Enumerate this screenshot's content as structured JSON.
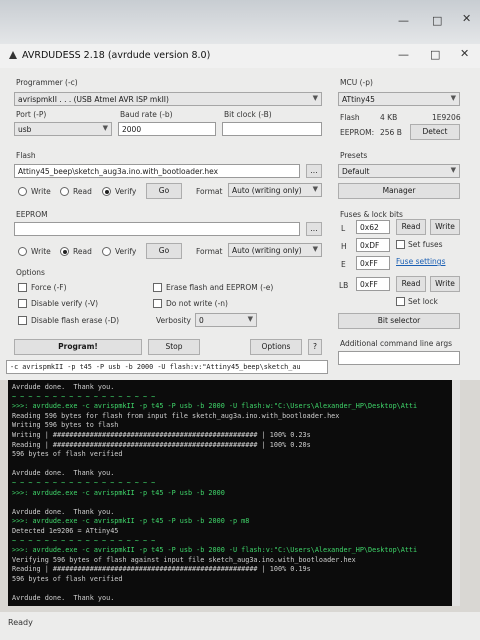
{
  "window": {
    "title": "AVRDUDESS 2.18 (avrdude version 8.0)",
    "status": "Ready"
  },
  "programmer": {
    "label": "Programmer (-c)",
    "value": "avrispmkII . . . (USB Atmel AVR ISP mkII)"
  },
  "port": {
    "label": "Port (-P)",
    "value": "usb"
  },
  "baud": {
    "label": "Baud rate (-b)",
    "value": "2000"
  },
  "bitclock": {
    "label": "Bit clock (-B)",
    "value": ""
  },
  "flash": {
    "label": "Flash",
    "file": "Attiny45_beep\\sketch_aug3a.ino.with_bootloader.hex",
    "browse": "...",
    "write": "Write",
    "read": "Read",
    "verify": "Verify",
    "selected": "verify",
    "go": "Go",
    "format_label": "Format",
    "format": "Auto (writing only)"
  },
  "eeprom": {
    "label": "EEPROM",
    "file": "",
    "browse": "...",
    "write": "Write",
    "read": "Read",
    "verify": "Verify",
    "selected": "read",
    "go": "Go",
    "format_label": "Format",
    "format": "Auto (writing only)"
  },
  "options": {
    "label": "Options",
    "force": "Force (-F)",
    "disable_verify": "Disable verify (-V)",
    "disable_flash_erase": "Disable flash erase (-D)",
    "erase": "Erase flash and EEPROM (-e)",
    "no_write": "Do not write (-n)",
    "verbosity_label": "Verbosity",
    "verbosity": "0"
  },
  "actions": {
    "program": "Program!",
    "stop": "Stop",
    "options": "Options",
    "help": "?"
  },
  "command": "-c avrispmkII -p t45 -P usb -b 2000 -U flash:v:\"Attiny45_beep\\sketch_au",
  "mcu": {
    "label": "MCU (-p)",
    "value": "ATtiny45",
    "flash_label": "Flash",
    "flash_size": "4 KB",
    "signature": "1E9206",
    "eeprom_label": "EEPROM:",
    "eeprom_size": "256 B",
    "detect": "Detect"
  },
  "presets": {
    "label": "Presets",
    "value": "Default",
    "manager": "Manager"
  },
  "fuses": {
    "label": "Fuses & lock bits",
    "l_label": "L",
    "l": "0x62",
    "h_label": "H",
    "h": "0xDF",
    "e_label": "E",
    "e": "0xFF",
    "lb_label": "LB",
    "lb": "0xFF",
    "read": "Read",
    "write": "Write",
    "set_fuses": "Set fuses",
    "fuse_settings": "Fuse settings",
    "set_lock": "Set lock",
    "bit_selector": "Bit selector"
  },
  "additional": {
    "label": "Additional command line args",
    "value": ""
  },
  "terminal": [
    {
      "text": "Avrdude done.  Thank you.",
      "style": "white"
    },
    {
      "text": "~ ~ ~ ~ ~ ~ ~ ~ ~ ~ ~ ~ ~ ~ ~ ~ ~ ~",
      "style": "green"
    },
    {
      "text": ">>>: avrdude.exe -c avrispmkII -p t45 -P usb -b 2000 -U flash:w:\"C:\\Users\\Alexander_HP\\Desktop\\Atti",
      "style": "green"
    },
    {
      "text": "Reading 596 bytes for flash from input file sketch_aug3a.ino.with_bootloader.hex",
      "style": "white"
    },
    {
      "text": "Writing 596 bytes to flash",
      "style": "white"
    },
    {
      "text": "Writing | ################################################## | 100% 0.23s",
      "style": "white"
    },
    {
      "text": "Reading | ################################################## | 100% 0.20s",
      "style": "white"
    },
    {
      "text": "596 bytes of flash verified",
      "style": "white"
    },
    {
      "text": "",
      "style": "white"
    },
    {
      "text": "Avrdude done.  Thank you.",
      "style": "white"
    },
    {
      "text": "~ ~ ~ ~ ~ ~ ~ ~ ~ ~ ~ ~ ~ ~ ~ ~ ~ ~",
      "style": "green"
    },
    {
      "text": ">>>: avrdude.exe -c avrispmkII -p t45 -P usb -b 2000",
      "style": "green"
    },
    {
      "text": "",
      "style": "white"
    },
    {
      "text": "Avrdude done.  Thank you.",
      "style": "white"
    },
    {
      "text": ">>>: avrdude.exe -c avrispmkII -p t45 -P usb -b 2000 -p m8",
      "style": "green"
    },
    {
      "text": "Detected 1e9206 = ATtiny45",
      "style": "white"
    },
    {
      "text": "~ ~ ~ ~ ~ ~ ~ ~ ~ ~ ~ ~ ~ ~ ~ ~ ~ ~",
      "style": "green"
    },
    {
      "text": ">>>: avrdude.exe -c avrispmkII -p t45 -P usb -b 2000 -U flash:v:\"C:\\Users\\Alexander_HP\\Desktop\\Atti",
      "style": "green"
    },
    {
      "text": "Verifying 596 bytes of flash against input file sketch_aug3a.ino.with_bootloader.hex",
      "style": "white"
    },
    {
      "text": "Reading | ################################################## | 100% 0.19s",
      "style": "white"
    },
    {
      "text": "596 bytes of flash verified",
      "style": "white"
    },
    {
      "text": "",
      "style": "white"
    },
    {
      "text": "Avrdude done.  Thank you.",
      "style": "white"
    }
  ],
  "colors": {
    "terminal_bg": "#0c0c0c",
    "terminal_green": "#3fd66a",
    "window_bg": "#ececeb"
  }
}
